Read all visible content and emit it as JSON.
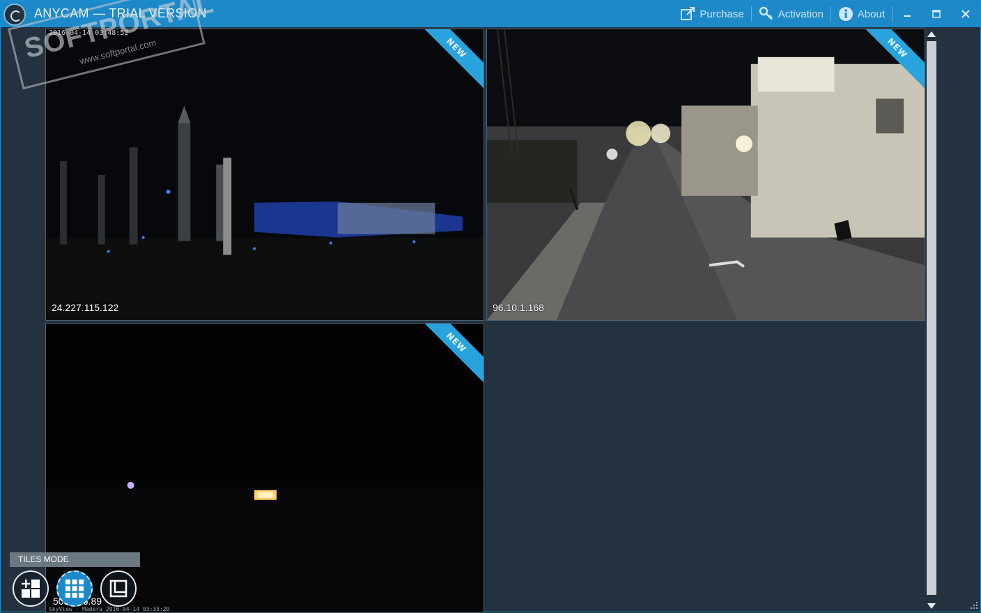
{
  "window": {
    "title": "ANYCAM — TRIAL VERSION"
  },
  "toolbar": {
    "purchase_label": "Purchase",
    "activation_label": "Activation",
    "about_label": "About"
  },
  "watermark": {
    "brand": "SOFTPORTAL",
    "url": "www.softportal.com"
  },
  "tiles": [
    {
      "ip": "24.227.115.122",
      "badge": "NEW",
      "timestamp": "2016-04-14 03:48:52"
    },
    {
      "ip": "96.10.1.168",
      "badge": "NEW"
    },
    {
      "ip": "50.·····6.89",
      "badge": "NEW",
      "footer": "SkyView - Madera 2016-04-14 03:33:20"
    }
  ],
  "mode": {
    "label": "TILES MODE",
    "active": "tiles"
  },
  "colors": {
    "accent": "#1e89c8",
    "badge": "#29a3de",
    "background": "#24323f"
  }
}
